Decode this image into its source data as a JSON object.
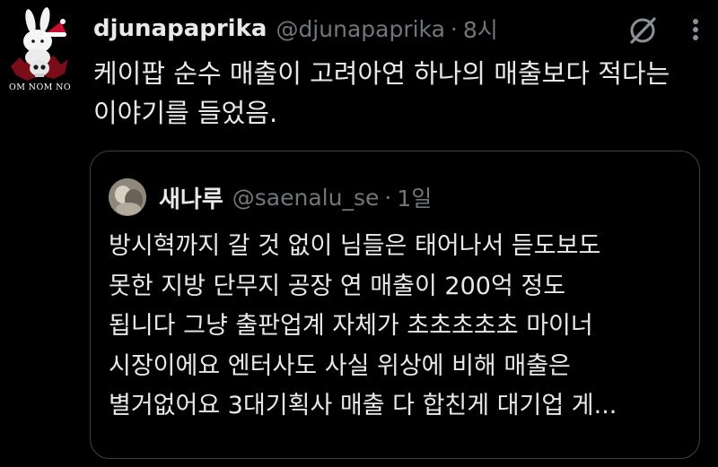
{
  "tweet": {
    "author": {
      "display_name": "djunapaprika",
      "handle": "@djunapaprika",
      "avatar_caption": "OM NOM NO",
      "avatar": "rabbit-with-santa-hat-and-skull"
    },
    "separator": "·",
    "time": "8시",
    "text_lines": [
      "케이팝 순수 매출이 고려아연 하나의 매출보다 적다는",
      "이야기를 들었음."
    ],
    "icons": {
      "grok": "grok-icon",
      "more": "more-icon"
    }
  },
  "quote": {
    "author": {
      "display_name": "새나루",
      "handle": "@saenalu_se",
      "avatar": "photo-avatar"
    },
    "separator": "·",
    "time": "1일",
    "text_lines": [
      "방시혁까지 갈 것 없이 님들은 태어나서 듣도보도",
      "못한 지방 단무지 공장 연 매출이 200억 정도",
      "됩니다 그냥 출판업계 자체가 초초초초초 마이너",
      "시장이에요 엔터사도 사실 위상에 비해 매출은",
      "별거없어요 3대기획사 매출 다 합친게 대기업 게..."
    ]
  },
  "colors": {
    "background": "#000000",
    "primary_text": "#e7e9ea",
    "secondary_text": "#71767b",
    "border": "#3e4144",
    "avatar_accent": "#c8102e"
  }
}
